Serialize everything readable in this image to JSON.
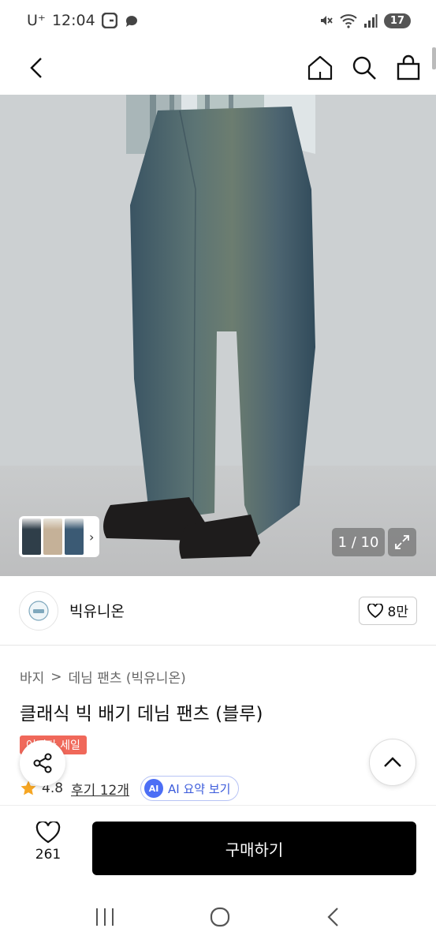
{
  "status_bar": {
    "carrier": "U⁺",
    "time": "12:04",
    "battery": "17"
  },
  "nav": {
    "back": "back",
    "home": "home",
    "search": "search",
    "cart": "cart"
  },
  "gallery": {
    "counter": "1 / 10"
  },
  "store": {
    "name": "빅유니온",
    "follow_count": "8만"
  },
  "breadcrumb": {
    "category": "바지",
    "separator": ">",
    "subcategory": "데님 팬츠 (빅유니온)"
  },
  "product": {
    "title": "클래식 빅 배기 데님 팬츠 (블루)",
    "badge": "어쩌다 세일"
  },
  "rating": {
    "value": "4.8",
    "reviews": "후기 12개",
    "ai_logo": "AI",
    "ai_label": "AI 요약 보기"
  },
  "bottom_bar": {
    "likes": "261",
    "buy_label": "구매하기"
  },
  "colors": {
    "buy_button": "#000000",
    "sale_badge": "#f0685a",
    "ai_accent": "#3b5bdb"
  }
}
